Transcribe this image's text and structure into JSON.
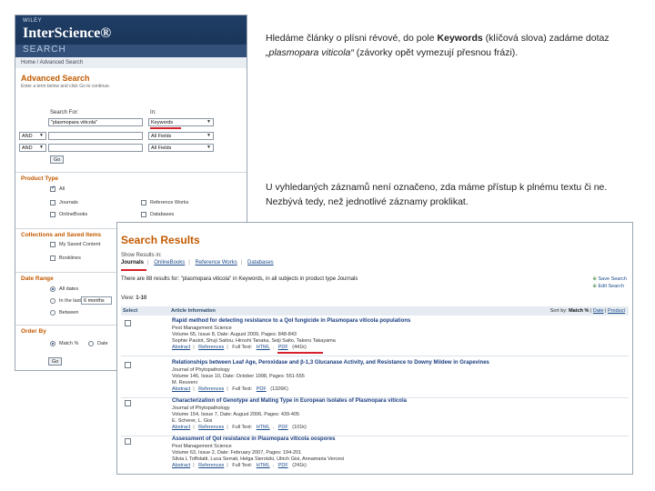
{
  "left_panel": {
    "brand_small": "WILEY",
    "brand": "InterScience®",
    "search_strip": "SEARCH",
    "breadcrumb": "Home / Advanced Search",
    "title": "Advanced Search",
    "hint": "Enter a term below and click Go to continue.",
    "search_for_label": "Search For:",
    "in_label": "In:",
    "query_value": "\"plasmopara viticola\"",
    "field_1": "Keywords",
    "field_2": "All Fields",
    "field_3": "All Fields",
    "op_1": "AND",
    "op_2": "AND",
    "go_label": "Go",
    "product_type_head": "Product Type",
    "product_options": [
      "All",
      "Journals",
      "OnlineBooks",
      "Reference Works",
      "Databases"
    ],
    "collections_head": "Collections and Saved Items",
    "collections_options": [
      "My Saved Content",
      "Booklines"
    ],
    "date_range_head": "Date Range",
    "date_options": [
      "All dates",
      "In the last",
      "Between"
    ],
    "date_in_last_value": "6 months",
    "order_by_head": "Order By",
    "order_options": [
      "Match %",
      "Date"
    ],
    "go_label_2": "Go"
  },
  "paragraph_1": [
    "Hledáme články o plísni révové, do pole ",
    "Keywords",
    " (klíčová slova) zadáme dotaz ",
    "„plasmopara viticola“",
    " (závorky opět vymezují přesnou frázi)."
  ],
  "paragraph_2": "U vyhledaných záznamů není označeno, zda máme přístup k plnému textu či ne. Nezbývá tedy, než jednotlivé záznamy proklikat.",
  "results_panel": {
    "title": "Search Results",
    "show_in_label": "Show Results in:",
    "tabs": [
      "Journals",
      "OnlineBooks",
      "Reference Works",
      "Databases"
    ],
    "summary": "There are 88 results for: \"plasmopara viticola\" in Keywords, in all subjects in product type Journals",
    "right_links": [
      "Save Search",
      "Edit Search"
    ],
    "view_label": "View:",
    "view_value": "1-10",
    "col_select": "Select",
    "col_info": "Article Information",
    "sort_label": "Sort by:",
    "sort_active": "Match %",
    "sort_date": "Date",
    "sort_product": "Product",
    "rows": [
      {
        "title": "Rapid method for detecting resistance to a QoI fungicide in Plasmopara viticola populations",
        "l1": "Pest Management Science",
        "l2": "Volume 65, Issue 8, Date: August 2009, Pages: 848-843",
        "l3": "Sophie Pautot, Shuji Saitou, Hiroshi Tanaka, Seiji Saito, Takeru Takayama",
        "links": [
          "Abstract",
          "References",
          "Full Text:",
          "HTML",
          "PDF",
          "(441k)"
        ]
      },
      {
        "title": "Relationships between Leaf Age, Peroxidase and β-1,3 Glucanase Activity, and Resistance to Downy Mildew in Grapevines",
        "l1": "Journal of Phytopathology",
        "l2": "Volume 146, Issue 10, Date: October 1998, Pages: 551-555",
        "l3": "M. Reuveni",
        "links": [
          "Abstract",
          "References",
          "Full Text:",
          "PDF",
          "(1326K)"
        ]
      },
      {
        "title": "Characterization of Genotype and Mating Type in European Isolates of Plasmopara viticola",
        "l1": "Journal of Phytopathology",
        "l2": "Volume 154, Issue 7, Date: August 2006, Pages: 439-405",
        "l3": "E. Scherer, L. Gisi",
        "links": [
          "Abstract",
          "References",
          "Full Text:",
          "HTML",
          "PDF",
          "(101k)"
        ]
      },
      {
        "title": "Assessment of QoI resistance in Plasmopara viticola oospores",
        "l1": "Pest Management Science",
        "l2": "Volume 63, Issue 2, Date: February 2007, Pages: 194-201",
        "l3": "Silvia L Toffolatti, Luca Serrati, Helga Sierotzki, Ulrich Gisi, Annamaria Vercesi",
        "links": [
          "Abstract",
          "References",
          "Full Text:",
          "HTML",
          "PDF",
          "(241k)"
        ]
      }
    ]
  },
  "colors": {
    "accent_orange": "#c35a00",
    "link_blue": "#1a4a8a",
    "highlight_red": "#d8202a",
    "banner_navy": "#1f3d66"
  }
}
